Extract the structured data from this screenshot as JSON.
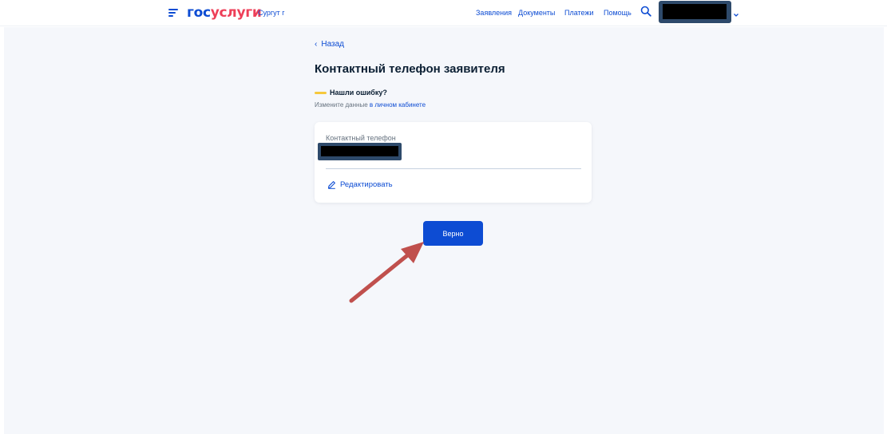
{
  "header": {
    "logo_part1": "гос",
    "logo_part2": "услуги",
    "region": "Сургут г",
    "nav": [
      {
        "label": "Заявления"
      },
      {
        "label": "Документы"
      },
      {
        "label": "Платежи"
      },
      {
        "label": "Помощь"
      }
    ],
    "search_icon": "search-icon",
    "menu_icon": "burger-menu-icon"
  },
  "main": {
    "back_label": "Назад",
    "title": "Контактный телефон заявителя",
    "notice": {
      "title": "Нашли ошибку?",
      "text_prefix": "Измените данные",
      "link_text": "в личном кабинете"
    },
    "card": {
      "field_label": "Контактный телефон",
      "edit_label": "Редактировать"
    },
    "confirm_label": "Верно"
  },
  "colors": {
    "brand_blue": "#0d4cd3",
    "brand_red": "#ee3f58",
    "notice_yellow": "#f6c83c",
    "annotation_arrow": "#c0504d"
  }
}
